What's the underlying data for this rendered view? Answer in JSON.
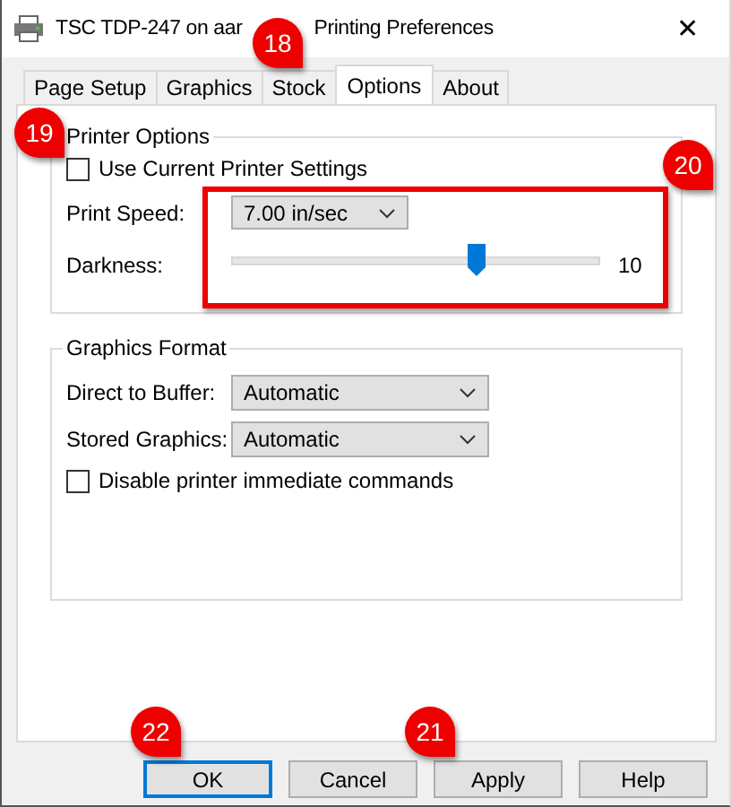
{
  "window": {
    "title_start": "TSC TDP-247 on aar",
    "title_end": "Printing Preferences",
    "close": "✕"
  },
  "tabs": [
    {
      "label": "Page Setup",
      "selected": false
    },
    {
      "label": "Graphics",
      "selected": false
    },
    {
      "label": "Stock",
      "selected": false
    },
    {
      "label": "Options",
      "selected": true
    },
    {
      "label": "About",
      "selected": false
    }
  ],
  "printer_options": {
    "title": "Printer Options",
    "use_current": {
      "label": "Use Current Printer Settings",
      "checked": false
    },
    "print_speed": {
      "label": "Print Speed:",
      "value": "7.00 in/sec"
    },
    "darkness": {
      "label": "Darkness:",
      "level": 0.667,
      "reading": "10"
    }
  },
  "graphics_format": {
    "title": "Graphics Format",
    "fields": [
      {
        "label": "Direct to Buffer:",
        "value": "Automatic"
      },
      {
        "label": "Stored Graphics:",
        "value": "Automatic"
      }
    ],
    "disable_immediate": {
      "label": "Disable printer immediate commands",
      "checked": false
    }
  },
  "buttons": [
    {
      "label": "OK",
      "selected": true
    },
    {
      "label": "Cancel",
      "selected": false
    },
    {
      "label": "Apply",
      "selected": false
    },
    {
      "label": "Help",
      "selected": false
    }
  ],
  "callouts": [
    {
      "label": "18"
    },
    {
      "label": "19"
    },
    {
      "label": "20"
    },
    {
      "label": "22"
    },
    {
      "label": "21"
    }
  ]
}
